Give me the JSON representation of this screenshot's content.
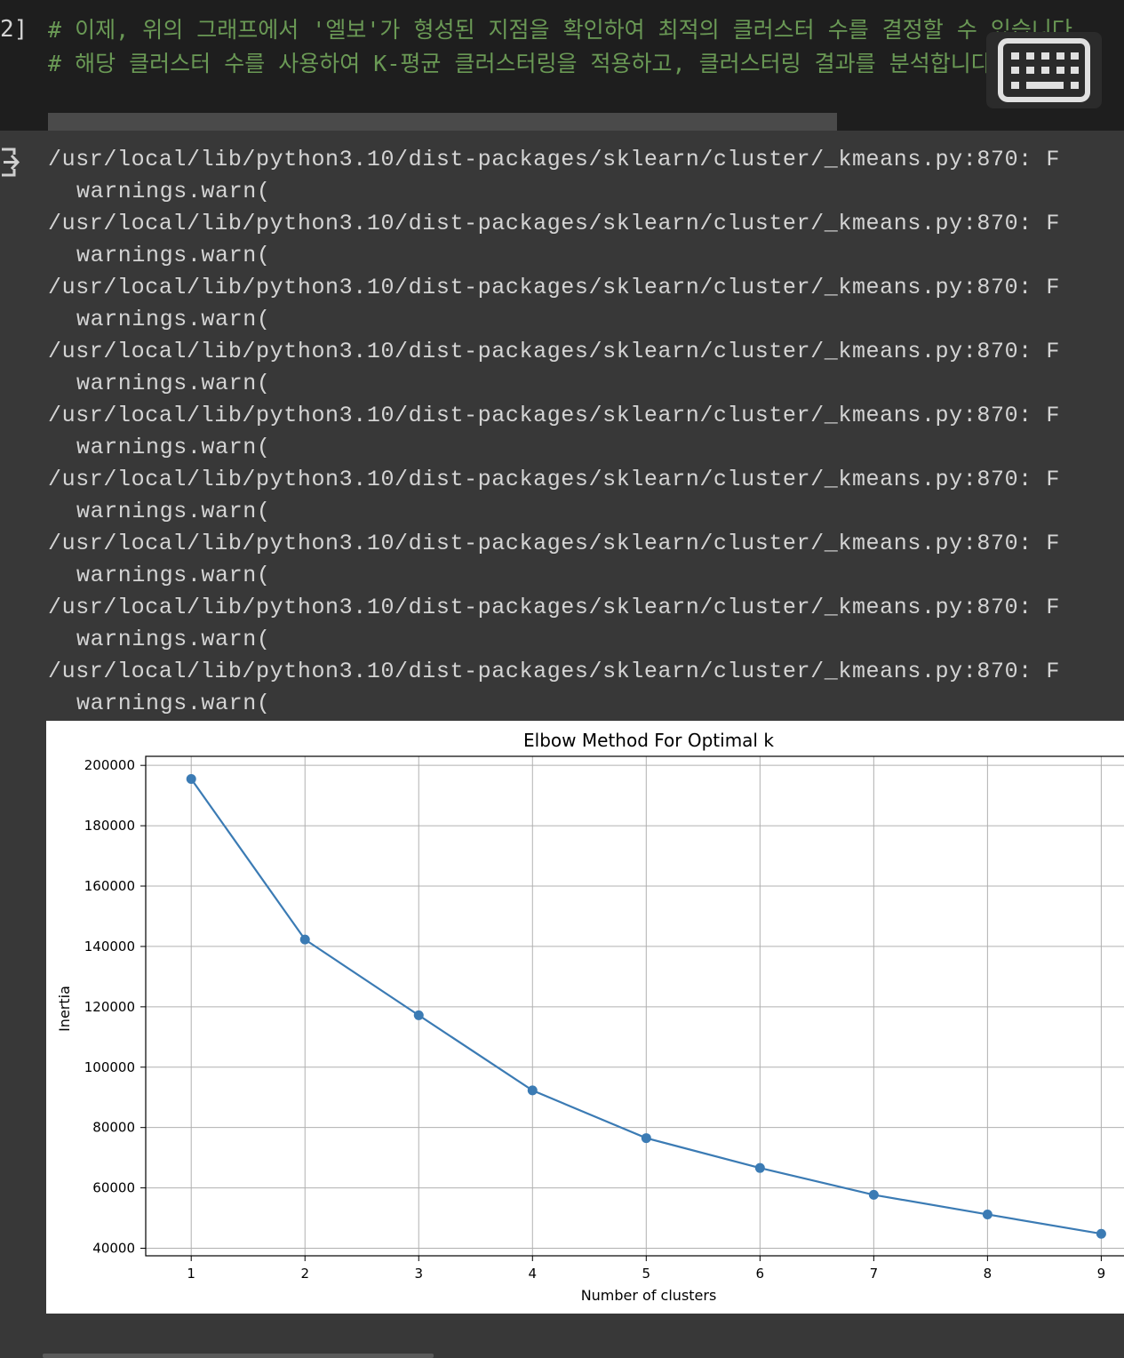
{
  "code_cell": {
    "execution_count": "2]",
    "lines": [
      "# 이제, 위의 그래프에서 '엘보'가 형성된 지점을 확인하여 최적의 클러스터 수를 결정할 수 있습니다.",
      "# 해당 클러스터 수를 사용하여 K-평균 클러스터링을 적용하고, 클러스터링 결과를 분석합니다."
    ]
  },
  "output": {
    "warnings": [
      {
        "path": "/usr/local/lib/python3.10/dist-packages/sklearn/cluster/_kmeans.py:870: F",
        "call": "warnings.warn("
      },
      {
        "path": "/usr/local/lib/python3.10/dist-packages/sklearn/cluster/_kmeans.py:870: F",
        "call": "warnings.warn("
      },
      {
        "path": "/usr/local/lib/python3.10/dist-packages/sklearn/cluster/_kmeans.py:870: F",
        "call": "warnings.warn("
      },
      {
        "path": "/usr/local/lib/python3.10/dist-packages/sklearn/cluster/_kmeans.py:870: F",
        "call": "warnings.warn("
      },
      {
        "path": "/usr/local/lib/python3.10/dist-packages/sklearn/cluster/_kmeans.py:870: F",
        "call": "warnings.warn("
      },
      {
        "path": "/usr/local/lib/python3.10/dist-packages/sklearn/cluster/_kmeans.py:870: F",
        "call": "warnings.warn("
      },
      {
        "path": "/usr/local/lib/python3.10/dist-packages/sklearn/cluster/_kmeans.py:870: F",
        "call": "warnings.warn("
      },
      {
        "path": "/usr/local/lib/python3.10/dist-packages/sklearn/cluster/_kmeans.py:870: F",
        "call": "warnings.warn("
      },
      {
        "path": "/usr/local/lib/python3.10/dist-packages/sklearn/cluster/_kmeans.py:870: F",
        "call": "warnings.warn("
      }
    ]
  },
  "icons": {
    "keyboard": "keyboard-icon",
    "output": "output-icon"
  },
  "colors": {
    "comment": "#6a9955",
    "line": "#3b7bb4",
    "grid": "#b0b0b0"
  },
  "chart_data": {
    "type": "line",
    "title": "Elbow Method For Optimal k",
    "xlabel": "Number of clusters",
    "ylabel": "Inertia",
    "x": [
      1,
      2,
      3,
      4,
      5,
      6,
      7,
      8,
      9
    ],
    "series": [
      {
        "values": [
          195500,
          142300,
          117200,
          92300,
          76500,
          66600,
          57700,
          51200,
          44800
        ]
      }
    ],
    "xticks": [
      "1",
      "2",
      "3",
      "4",
      "5",
      "6",
      "7",
      "8",
      "9"
    ],
    "yticks": [
      "40000",
      "60000",
      "80000",
      "100000",
      "120000",
      "140000",
      "160000",
      "180000",
      "200000"
    ],
    "xlim": [
      0.6,
      9.2
    ],
    "ylim": [
      37500,
      203000
    ],
    "grid": true,
    "marker": "circle"
  }
}
